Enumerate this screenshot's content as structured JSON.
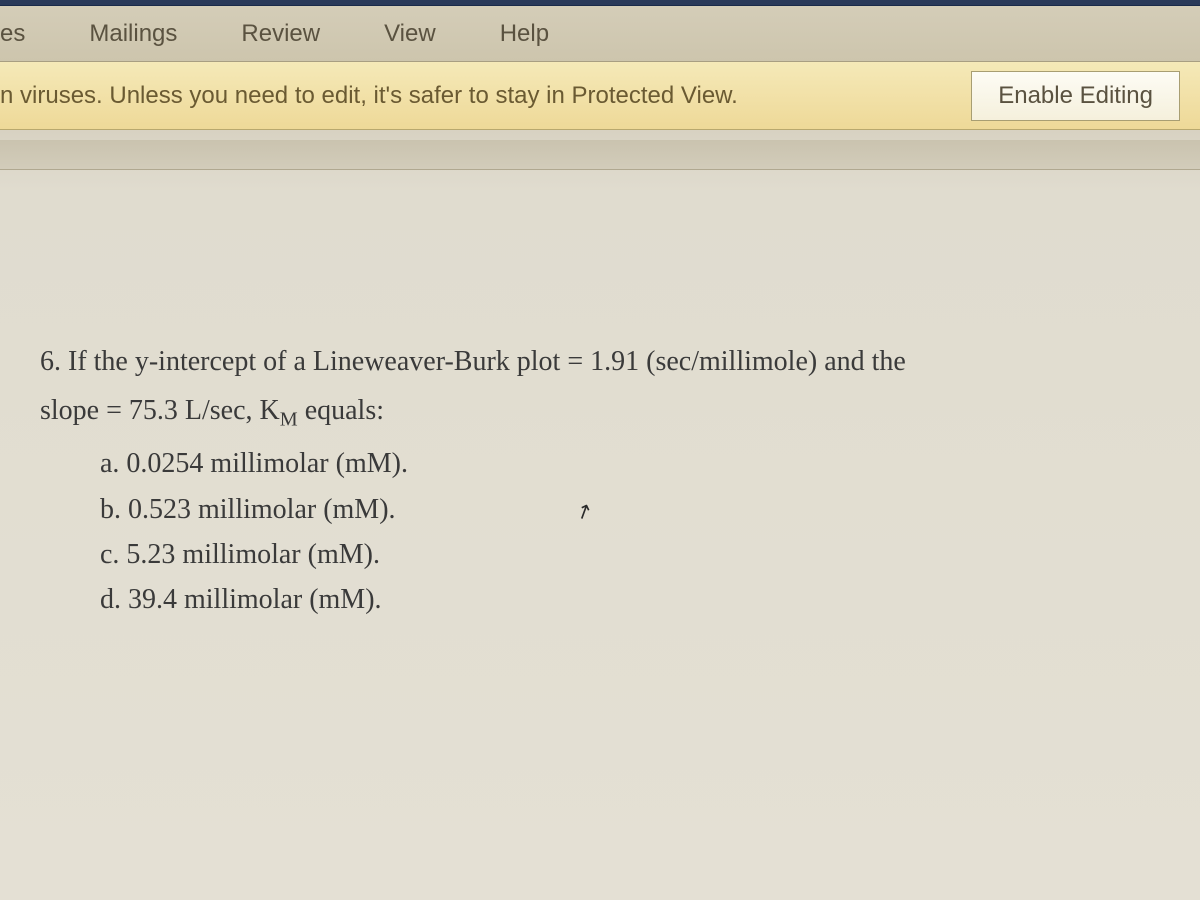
{
  "ribbon": {
    "tabs": {
      "partial": "es",
      "mailings": "Mailings",
      "review": "Review",
      "view": "View",
      "help": "Help"
    }
  },
  "protected_view": {
    "message": "n viruses. Unless you need to edit, it's safer to stay in Protected View.",
    "button": "Enable Editing"
  },
  "document": {
    "question": {
      "stem_line1": "6. If the y-intercept of a Lineweaver-Burk plot = 1.91 (sec/millimole) and the",
      "stem_line2_prefix": "slope = 75.3 L/sec, K",
      "stem_line2_subscript": "M",
      "stem_line2_suffix": " equals:",
      "options": {
        "a": "a. 0.0254 millimolar (mM).",
        "b": "b. 0.523 millimolar (mM).",
        "c": "c. 5.23 millimolar (mM).",
        "d": "d. 39.4 millimolar (mM)."
      }
    }
  },
  "icons": {
    "cursor": "↗"
  }
}
